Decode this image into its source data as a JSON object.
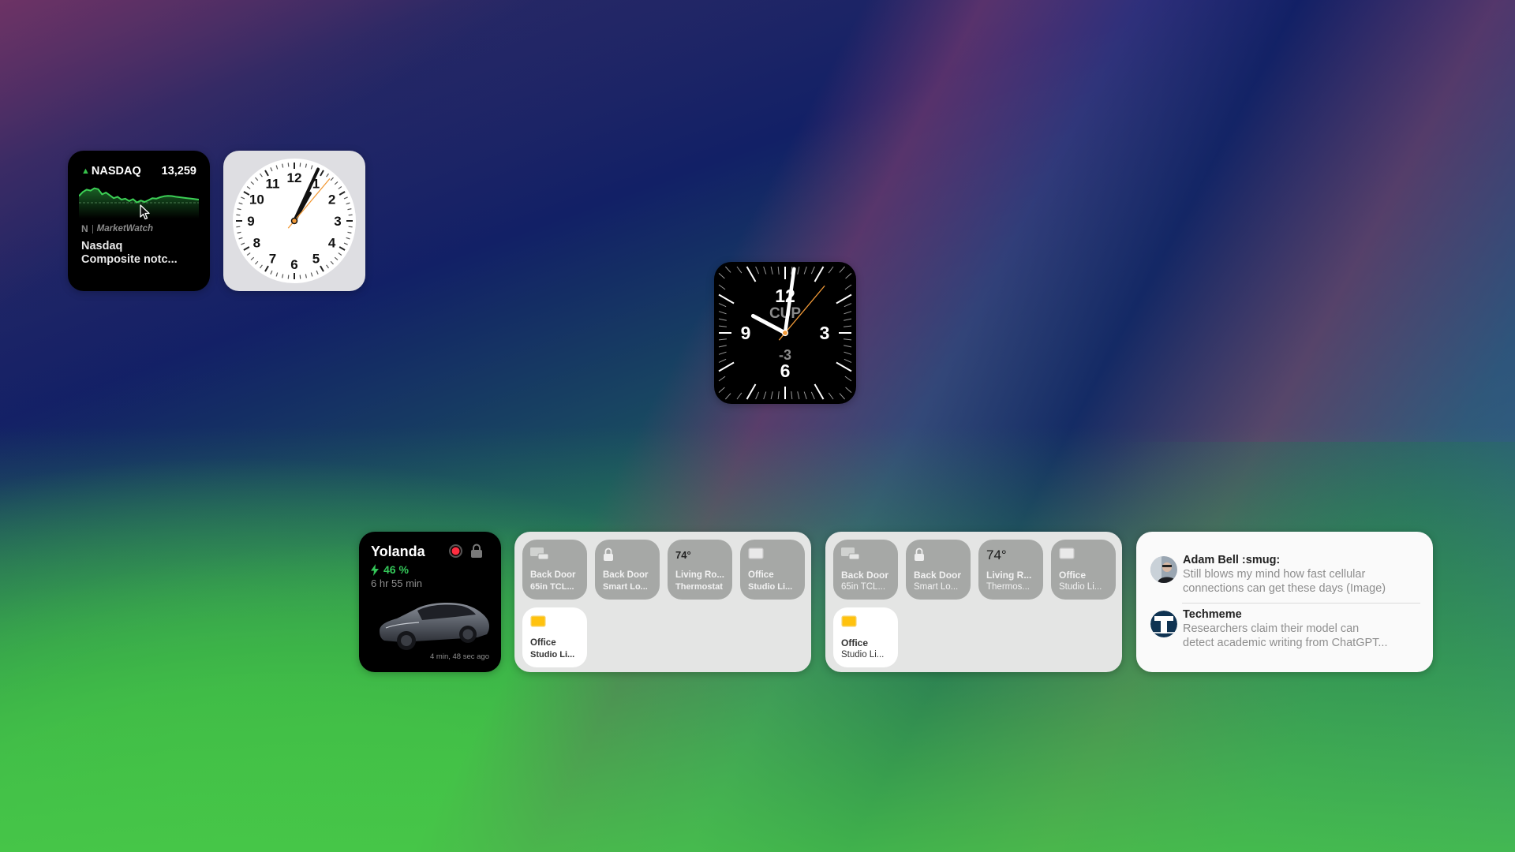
{
  "desktop": {
    "wallpaper": "macOS Sonoma gradient (purple, navy, teal, green)"
  },
  "stocks_widget": {
    "symbol": "NASDAQ",
    "direction": "up",
    "value": "13,259",
    "source": "MarketWatch",
    "source_icon": "stocks-news-icon",
    "headline": "Nasdaq Composite notc...",
    "headline_lines": [
      "Nasdaq",
      "Composite notc..."
    ],
    "accent_color": "#34c759",
    "sparkline": [
      0.55,
      0.72,
      0.82,
      0.78,
      0.88,
      0.84,
      0.62,
      0.7,
      0.58,
      0.46,
      0.52,
      0.4,
      0.44,
      0.34,
      0.42,
      0.28,
      0.36,
      0.3,
      0.38,
      0.46,
      0.44,
      0.5,
      0.54,
      0.56,
      0.55,
      0.52,
      0.5,
      0.48,
      0.46,
      0.44,
      0.42,
      0.4
    ]
  },
  "clock_white": {
    "numbers": [
      "12",
      "1",
      "2",
      "3",
      "4",
      "5",
      "6",
      "7",
      "8",
      "9",
      "10",
      "11"
    ],
    "time": {
      "hour": 12,
      "minute": 4,
      "second": 7
    }
  },
  "clock_dark": {
    "numbers": [
      "12",
      "3",
      "6",
      "9"
    ],
    "city": "CUP",
    "offset": "-3",
    "time": {
      "hour": 9,
      "minute": 2,
      "second": 7
    }
  },
  "tesla_widget": {
    "name": "Yolanda",
    "charge": "46 %",
    "time_remaining": "6 hr 55 min",
    "updated": "4 min, 48 sec ago",
    "status_color": "#ff2d40"
  },
  "home_widget_1": {
    "tiles": [
      {
        "icon": "tv-icon",
        "line1": "Back Door",
        "line2": "65in TCL...",
        "active": false
      },
      {
        "icon": "lock-icon",
        "line1": "Back Door",
        "line2": "Smart Lo...",
        "active": false
      },
      {
        "icon": "temperature",
        "temp": "74°",
        "line1": "Living Ro...",
        "line2": "Thermostat",
        "active": false
      },
      {
        "icon": "light-panel-icon",
        "line1": "Office",
        "line2": "Studio Li...",
        "active": false
      },
      {
        "icon": "light-panel-on-icon",
        "line1": "Office",
        "line2": "Studio Li...",
        "active": true
      }
    ]
  },
  "home_widget_2": {
    "tiles": [
      {
        "icon": "tv-icon",
        "line1": "Back Door",
        "line2": "65in TCL...",
        "active": false
      },
      {
        "icon": "lock-icon",
        "line1": "Back Door",
        "line2": "Smart Lo...",
        "active": false
      },
      {
        "icon": "temperature",
        "temp": "74°",
        "line1": "Living R...",
        "line2": "Thermos...",
        "active": false
      },
      {
        "icon": "light-panel-icon",
        "line1": "Office",
        "line2": "Studio Li...",
        "active": false
      },
      {
        "icon": "light-panel-on-icon",
        "line1": "Office",
        "line2": "Studio Li...",
        "active": true
      }
    ]
  },
  "notifications_widget": {
    "items": [
      {
        "sender": "Adam Bell :smug:",
        "lines": [
          "Still blows my mind how fast cellular",
          "connections can get these days (Image)"
        ],
        "avatar": "person-avatar"
      },
      {
        "sender": "Techmeme",
        "lines": [
          "Researchers claim their model can",
          "detect academic writing from ChatGPT..."
        ],
        "avatar": "techmeme-logo"
      }
    ]
  }
}
